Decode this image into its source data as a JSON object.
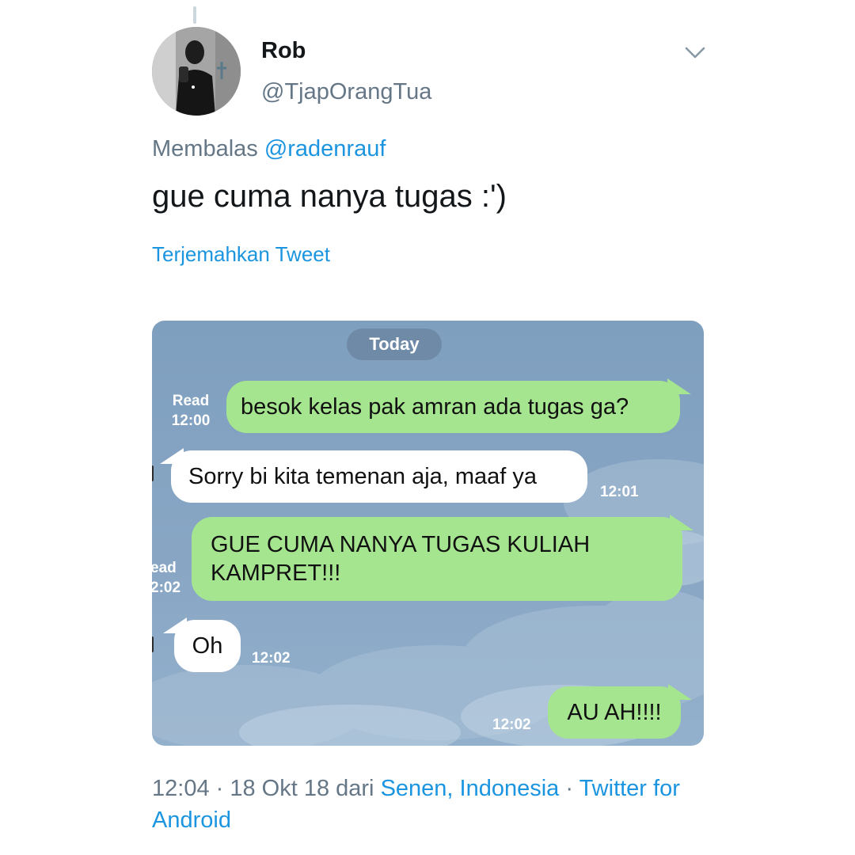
{
  "tweet": {
    "author": {
      "display_name": "Rob",
      "handle": "@TjapOrangTua"
    },
    "reply_prefix": "Membalas ",
    "reply_mention": "@radenrauf",
    "text": "gue cuma nanya tugas :')",
    "translate_label": "Terjemahkan Tweet",
    "menu_icon": "chevron-down-icon"
  },
  "chat": {
    "date_label": "Today",
    "messages": [
      {
        "direction": "outgoing",
        "text": "besok kelas pak amran ada tugas ga?",
        "status": "Read",
        "time": "12:00"
      },
      {
        "direction": "incoming",
        "text": "Sorry bi kita temenan aja, maaf ya",
        "time": "12:01"
      },
      {
        "direction": "outgoing",
        "text_lines": [
          "GUE CUMA NANYA TUGAS KULIAH",
          "KAMPRET!!!"
        ],
        "status_partial": "ead",
        "time_partial": "2:02"
      },
      {
        "direction": "incoming",
        "text": "Oh",
        "time": "12:02"
      },
      {
        "direction": "outgoing",
        "text": "AU AH!!!!",
        "time": "12:02"
      }
    ]
  },
  "footer": {
    "meta_text": "12:04 · 18 Okt 18 dari ",
    "location": "Senen, Indonesia",
    "separator": " · ",
    "source": "Twitter for Android"
  },
  "colors": {
    "link": "#1b95e0",
    "secondary_text": "#657786",
    "outgoing_bubble": "#a6e58f",
    "incoming_bubble": "#ffffff",
    "chat_background": "#88a6c4"
  }
}
